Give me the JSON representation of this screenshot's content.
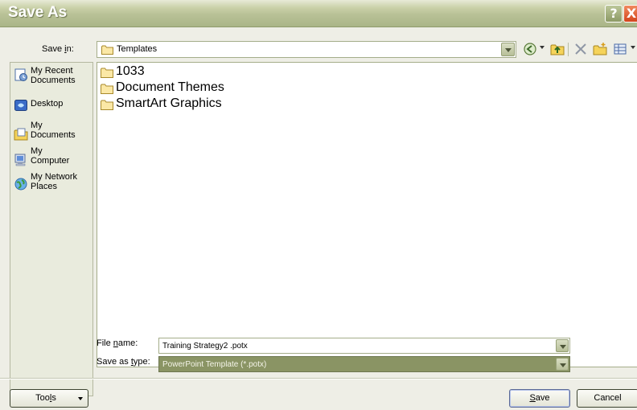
{
  "window": {
    "title": "Save As",
    "help_label": "?",
    "close_label": "X"
  },
  "toolbar": {
    "save_in_prefix": "Save ",
    "save_in_hotkey": "i",
    "save_in_suffix": "n:",
    "current_folder": "Templates",
    "icons": [
      "back-icon",
      "up-one-level-icon",
      "delete-icon",
      "new-folder-icon",
      "views-icon"
    ]
  },
  "places": [
    {
      "label_line1": "My Recent",
      "label_line2": "Documents",
      "icon": "recent-documents-icon"
    },
    {
      "label_line1": "Desktop",
      "label_line2": "",
      "icon": "desktop-icon"
    },
    {
      "label_line1": "My",
      "label_line2": "Documents",
      "icon": "my-documents-icon"
    },
    {
      "label_line1": "My",
      "label_line2": "Computer",
      "icon": "my-computer-icon"
    },
    {
      "label_line1": "My Network",
      "label_line2": "Places",
      "icon": "network-places-icon"
    }
  ],
  "files": [
    {
      "name": "1033"
    },
    {
      "name": "Document Themes"
    },
    {
      "name": "SmartArt Graphics"
    }
  ],
  "form": {
    "file_name_prefix": "File ",
    "file_name_hotkey": "n",
    "file_name_suffix": "ame:",
    "file_name_value": "Training Strategy2 .potx",
    "type_prefix": "Save as ",
    "type_hotkey": "t",
    "type_suffix": "ype:",
    "type_value": "PowerPoint Template (*.potx)"
  },
  "buttons": {
    "tools_prefix": "Too",
    "tools_hotkey": "l",
    "tools_suffix": "s",
    "save_hotkey": "S",
    "save_suffix": "ave",
    "cancel": "Cancel"
  },
  "colors": {
    "titlebar": "#b8c196",
    "dialog_bg": "#eeeee6",
    "selected_type_bg": "#8a9464",
    "close_button": "#d3441c"
  }
}
